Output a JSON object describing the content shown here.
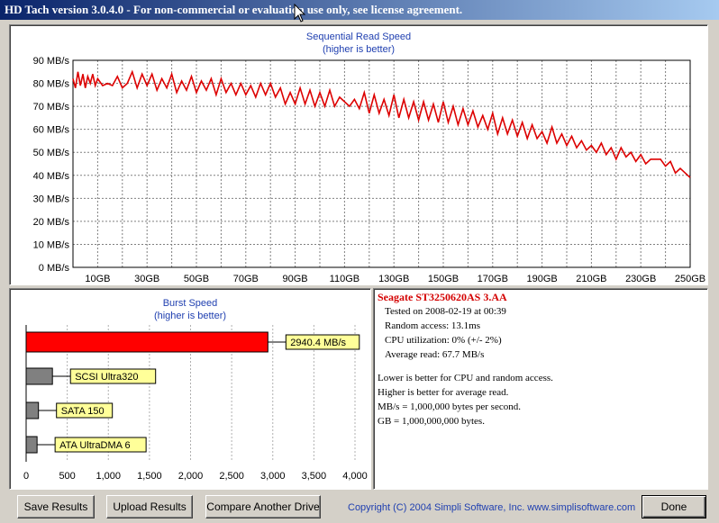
{
  "window": {
    "title": "HD Tach version 3.0.4.0  - For non-commercial or evaluation use only, see license agreement."
  },
  "read_chart": {
    "title_line1": "Sequential Read Speed",
    "title_line2": "(higher is better)"
  },
  "burst_chart": {
    "title_line1": "Burst Speed",
    "title_line2": "(higher is better)"
  },
  "info": {
    "drive": "Seagate ST3250620AS 3.AA",
    "tested": "Tested on 2008-02-19 at 00:39",
    "random_access": "Random access: 13.1ms",
    "cpu": "CPU utilization: 0% (+/- 2%)",
    "average_read": "Average read: 67.7 MB/s",
    "note1": "Lower is better for CPU and random access.",
    "note2": "Higher is better for average read.",
    "note3": "MB/s = 1,000,000 bytes per second.",
    "note4": "GB = 1,000,000,000 bytes."
  },
  "buttons": {
    "save": "Save Results",
    "upload": "Upload Results",
    "compare": "Compare Another Drive",
    "done": "Done"
  },
  "copyright": "Copyright (C) 2004 Simpli Software, Inc. www.simplisoftware.com",
  "colors": {
    "read_line": "#dd0000",
    "tested_bar": "#ff0000",
    "reference_bar": "#808080",
    "label_bg": "#ffff99",
    "title_blue": "#1f3fb0"
  },
  "chart_data": [
    {
      "type": "line",
      "title": "Sequential Read Speed",
      "subtitle": "(higher is better)",
      "ylabel": "",
      "xlabel": "",
      "ylim": [
        0,
        90
      ],
      "xlim": [
        0,
        250
      ],
      "grid": true,
      "y_ticks": [
        "0 MB/s",
        "10 MB/s",
        "20 MB/s",
        "30 MB/s",
        "40 MB/s",
        "50 MB/s",
        "60 MB/s",
        "70 MB/s",
        "80 MB/s",
        "90 MB/s"
      ],
      "y_tick_values": [
        0,
        10,
        20,
        30,
        40,
        50,
        60,
        70,
        80,
        90
      ],
      "x_ticks": [
        "10GB",
        "30GB",
        "50GB",
        "70GB",
        "90GB",
        "110GB",
        "130GB",
        "150GB",
        "170GB",
        "190GB",
        "210GB",
        "230GB",
        "250GB"
      ],
      "x_tick_values": [
        10,
        30,
        50,
        70,
        90,
        110,
        130,
        150,
        170,
        190,
        210,
        230,
        250
      ],
      "series": [
        {
          "x": [
            0,
            1,
            2,
            3,
            4,
            5,
            6,
            7,
            8,
            9,
            10,
            12,
            14,
            16,
            18,
            20,
            22,
            24,
            26,
            28,
            30,
            32,
            34,
            36,
            38,
            40,
            42,
            44,
            46,
            48,
            50,
            52,
            54,
            56,
            58,
            60,
            62,
            64,
            66,
            68,
            70,
            72,
            74,
            76,
            78,
            80,
            82,
            84,
            86,
            88,
            90,
            92,
            94,
            96,
            98,
            100,
            102,
            104,
            106,
            108,
            110,
            112,
            114,
            116,
            118,
            120,
            122,
            124,
            126,
            128,
            130,
            132,
            134,
            136,
            138,
            140,
            142,
            144,
            146,
            148,
            150,
            152,
            154,
            156,
            158,
            160,
            162,
            164,
            166,
            168,
            170,
            172,
            174,
            176,
            178,
            180,
            182,
            184,
            186,
            188,
            190,
            192,
            194,
            196,
            198,
            200,
            202,
            204,
            206,
            208,
            210,
            212,
            214,
            216,
            218,
            220,
            222,
            224,
            226,
            228,
            230,
            232,
            234,
            236,
            238,
            240,
            242,
            244,
            246,
            248,
            250
          ],
          "y": [
            82,
            78,
            85,
            79,
            84,
            78,
            83,
            80,
            84,
            79,
            82,
            79,
            80,
            79,
            83,
            78,
            80,
            85,
            78,
            84,
            79,
            84,
            77,
            82,
            78,
            84,
            76,
            81,
            77,
            83,
            76,
            81,
            77,
            82,
            75,
            82,
            76,
            80,
            75,
            80,
            75,
            79,
            74,
            80,
            75,
            80,
            74,
            78,
            71,
            76,
            71,
            78,
            71,
            77,
            70,
            76,
            70,
            77,
            70,
            74,
            72,
            70,
            73,
            69,
            76,
            67,
            75,
            67,
            73,
            66,
            75,
            65,
            73,
            65,
            72,
            64,
            72,
            64,
            71,
            63,
            72,
            63,
            70,
            62,
            69,
            62,
            68,
            61,
            66,
            60,
            67,
            58,
            65,
            58,
            64,
            57,
            63,
            56,
            62,
            56,
            59,
            54,
            61,
            54,
            58,
            53,
            57,
            52,
            55,
            51,
            53,
            50,
            54,
            49,
            52,
            47,
            52,
            48,
            50,
            46,
            49,
            45,
            47,
            47,
            47,
            44,
            46,
            41,
            43,
            41,
            39
          ]
        }
      ]
    },
    {
      "type": "bar",
      "orientation": "horizontal",
      "title": "Burst Speed",
      "subtitle": "(higher is better)",
      "xlim": [
        0,
        4000
      ],
      "x_ticks": [
        "0",
        "500",
        "1,000",
        "1,500",
        "2,000",
        "2,500",
        "3,000",
        "3,500",
        "4,000"
      ],
      "x_tick_values": [
        0,
        500,
        1000,
        1500,
        2000,
        2500,
        3000,
        3500,
        4000
      ],
      "categories": [
        "2940.4 MB/s",
        "SCSI Ultra320",
        "SATA 150",
        "ATA UltraDMA 6"
      ],
      "values": [
        2940.4,
        320,
        150,
        133
      ]
    }
  ]
}
